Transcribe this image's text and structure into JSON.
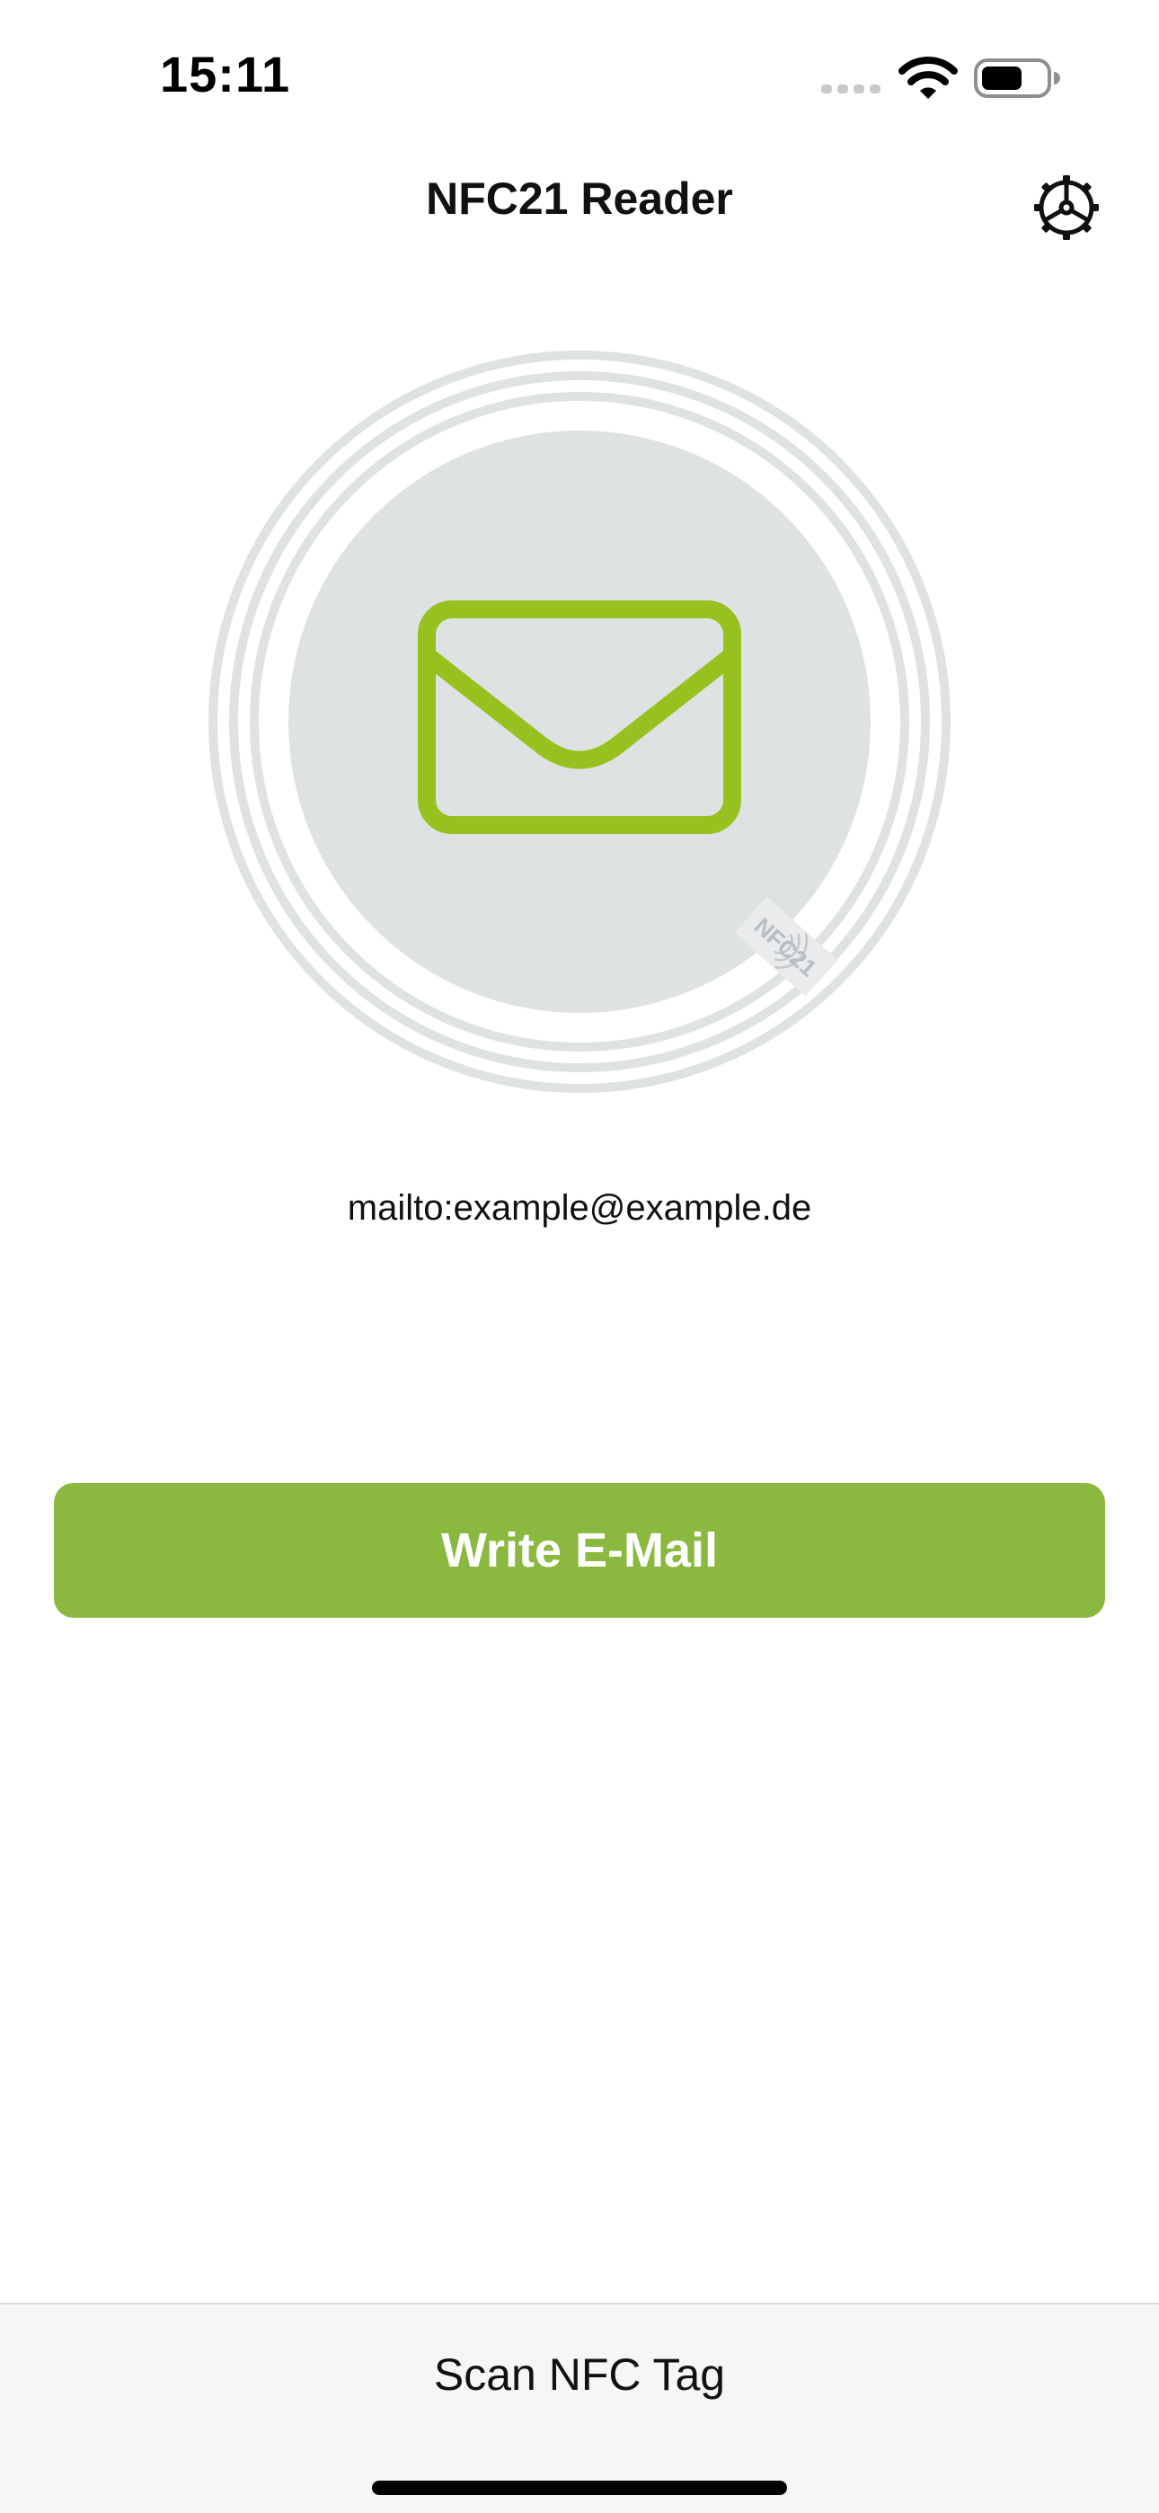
{
  "status_bar": {
    "time": "15:11",
    "signal_icon": "cellular-signal-icon",
    "wifi_icon": "wifi-icon",
    "battery_icon": "battery-icon"
  },
  "nav": {
    "title": "NFC21 Reader",
    "settings_icon": "gear-icon"
  },
  "tag": {
    "record_icon": "envelope-icon",
    "badge_text": "NFC21",
    "record_text": "mailto:example@example.de"
  },
  "actions": {
    "primary_label": "Write E-Mail"
  },
  "bottom_bar": {
    "scan_label": "Scan NFC Tag"
  },
  "colors": {
    "accent": "#8bb83f",
    "icon_green": "#97c11f",
    "disc_gray": "#dfe2e3",
    "ring_gray": "#dfe2e3",
    "bottom_bar_bg": "#f6f6f6"
  }
}
